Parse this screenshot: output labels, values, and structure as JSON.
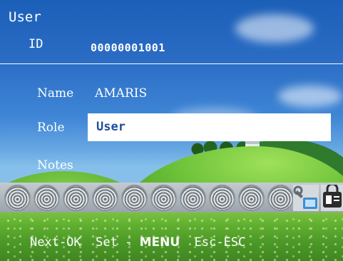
{
  "header": {
    "title": "User",
    "id_label": "ID",
    "id_value": "00000001001"
  },
  "fields": {
    "name_label": "Name",
    "name_value": "AMARIS",
    "role_label": "Role",
    "role_value": "User",
    "notes_label": "Notes"
  },
  "enroll_strip": {
    "fingerprint_count": 10,
    "fingerprint_icon": "fingerprint-icon",
    "tool_icon": "wrench-icon",
    "id_card_icon": "id-card-icon"
  },
  "footer": {
    "next_label": "Next-OK",
    "set_label": "Set -",
    "menu_label": "MENU",
    "esc_label": "Esc-ESC"
  },
  "colors": {
    "highlight_bg": "#ffffff",
    "highlight_text": "#1f4e9a",
    "text": "#ffffff"
  }
}
